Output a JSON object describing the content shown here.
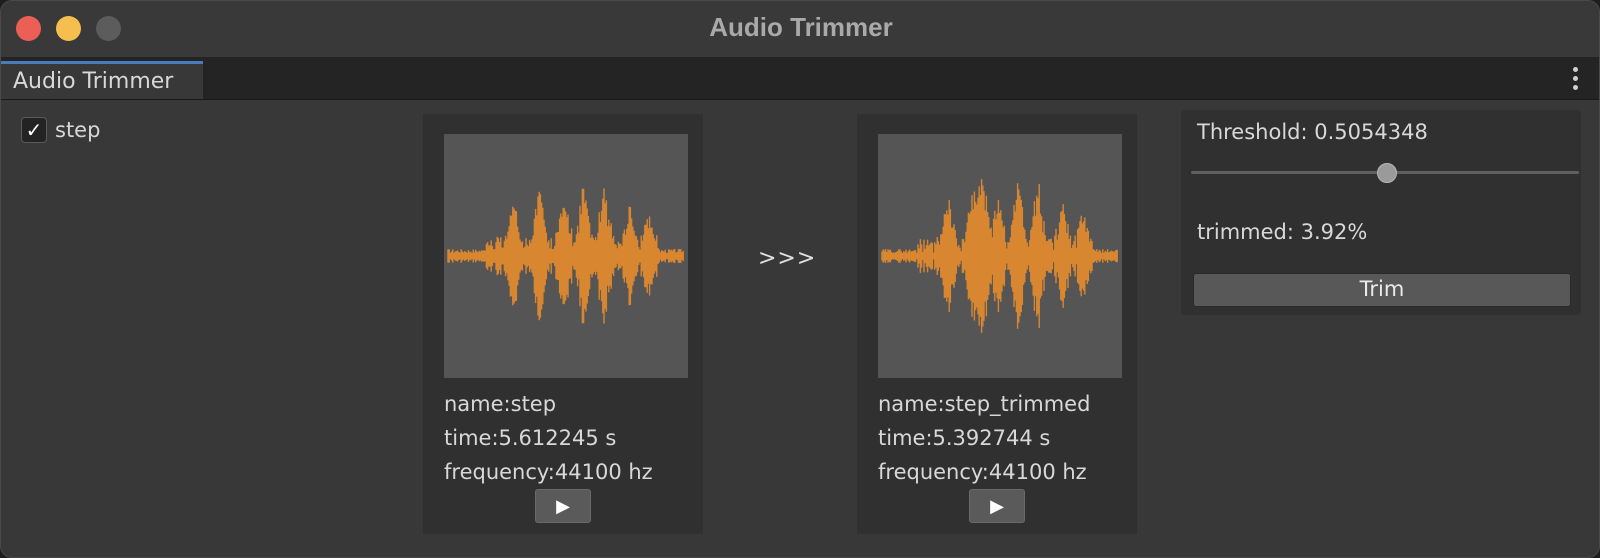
{
  "window": {
    "title": "Audio Trimmer"
  },
  "tab": {
    "label": "Audio Trimmer"
  },
  "file_list": {
    "items": [
      {
        "label": "step",
        "checked": true
      }
    ]
  },
  "source_clip": {
    "name": "name:step",
    "time": "time:5.612245 s",
    "frequency": "frequency:44100 hz",
    "play_icon": "play-icon"
  },
  "arrow_text": ">>>",
  "trimmed_clip": {
    "name": "name:step_trimmed",
    "time": "time:5.392744 s",
    "frequency": "frequency:44100 hz",
    "play_icon": "play-icon"
  },
  "settings": {
    "threshold_label": "Threshold: 0.5054348",
    "threshold_value": 0.5054348,
    "trimmed_label": "trimmed: 3.92%",
    "trim_button": "Trim"
  },
  "colors": {
    "waveform": "#f0902a",
    "tab_accent": "#4a7cbd",
    "close": "#ec5f57",
    "minimize": "#f5be4f"
  }
}
